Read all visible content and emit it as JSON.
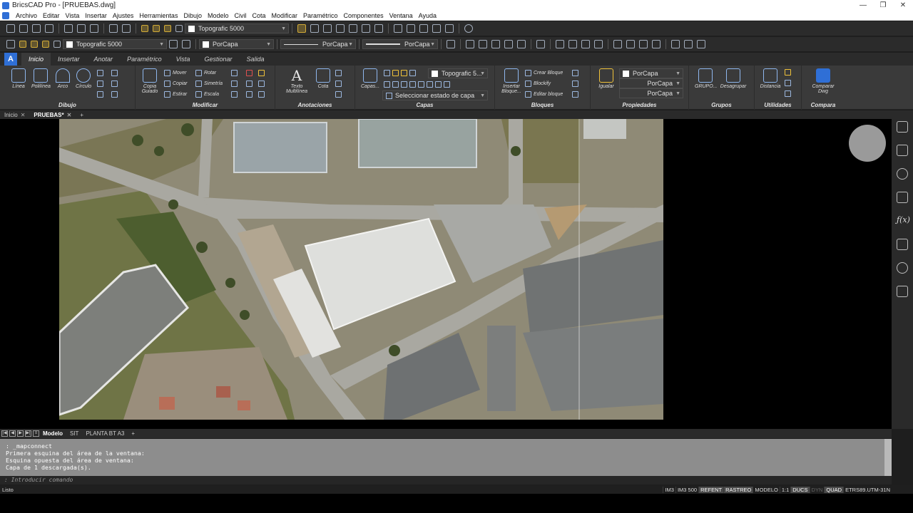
{
  "window": {
    "title": "BricsCAD Pro - [PRUEBAS.dwg]",
    "controls": [
      "—",
      "❐",
      "✕"
    ]
  },
  "menu": [
    "Archivo",
    "Editar",
    "Vista",
    "Insertar",
    "Ajustes",
    "Herramientas",
    "Dibujo",
    "Modelo",
    "Civil",
    "Cota",
    "Modificar",
    "Paramétrico",
    "Componentes",
    "Ventana",
    "Ayuda"
  ],
  "toolbar1": {
    "layer_combo": "Topografic 5000"
  },
  "toolbar2": {
    "layer_combo": "Topografic 5000",
    "color_combo": "PorCapa",
    "linetype_combo": "PorCapa",
    "lineweight_combo": "PorCapa"
  },
  "ribbon_tabs": [
    "Inicio",
    "Insertar",
    "Anotar",
    "Paramétrico",
    "Vista",
    "Gestionar",
    "Salida"
  ],
  "ribbon_logo": "A",
  "ribbon": {
    "dibujo": {
      "title": "Dibujo",
      "linea": "Línea",
      "polilinea": "Polilínea",
      "arco": "Arco",
      "circulo": "Círculo"
    },
    "modificar": {
      "title": "Modificar",
      "copia_guiado_1": "Copia",
      "copia_guiado_2": "Guiado",
      "mover": "Mover",
      "copiar": "Copiar",
      "estirar": "Estirar",
      "rotar": "Rotar",
      "simetria": "Simetría",
      "escala": "Escala"
    },
    "anotaciones": {
      "title": "Anotaciones",
      "texto_1": "Texto",
      "texto_2": "Multilínea",
      "cota": "Cota"
    },
    "capas": {
      "title": "Capas",
      "capas_btn": "Capas...",
      "layer_combo": "Topografic 5...",
      "estado": "Seleccionar estado de capa"
    },
    "bloques": {
      "title": "Bloques",
      "insertar_1": "Insertar",
      "insertar_2": "Bloque...",
      "crear": "Crear Bloque",
      "blockify": "Blockify",
      "editar": "Editar bloque"
    },
    "propiedades": {
      "title": "Propiedades",
      "igualar": "Igualar",
      "color": "PorCapa",
      "linetype": "PorCapa",
      "lineweight": "PorCapa"
    },
    "grupos": {
      "title": "Grupos",
      "grupo": "GRUPO...",
      "desagrupar": "Desagrupar"
    },
    "utilidades": {
      "title": "Utilidades",
      "distancia": "Distancia"
    },
    "compara": {
      "title": "Compara",
      "comparar_1": "Comparar",
      "comparar_2": "Dwg"
    }
  },
  "doc_tabs": {
    "inicio": "Inicio",
    "pruebas": "PRUEBAS*",
    "close": "✕",
    "add": "+"
  },
  "layout_tabs": [
    "Modelo",
    "SIT",
    "PLANTA BT A3"
  ],
  "layout_add": "+",
  "command_history": [
    ": _mapconnect",
    "Primera esquina del área de la ventana:",
    "Esquina opuesta del área de ventana:",
    "Capa de 1 descargada(s)."
  ],
  "command_prompt": ": Introducir comando",
  "status": {
    "left": "Listo",
    "items": [
      "IM3",
      "IM3 500",
      "REFENT",
      "RASTREO",
      "MODELO",
      "1:1",
      "DUCS",
      "DYN",
      "QUAD",
      "ETRS89.UTM-31N"
    ]
  },
  "colors": {
    "accent": "#2f6fd6",
    "ribbon_bg": "#3a3a3a",
    "toolbar_bg": "#2b2b2b",
    "cmd_bg": "#8d8d8d"
  }
}
